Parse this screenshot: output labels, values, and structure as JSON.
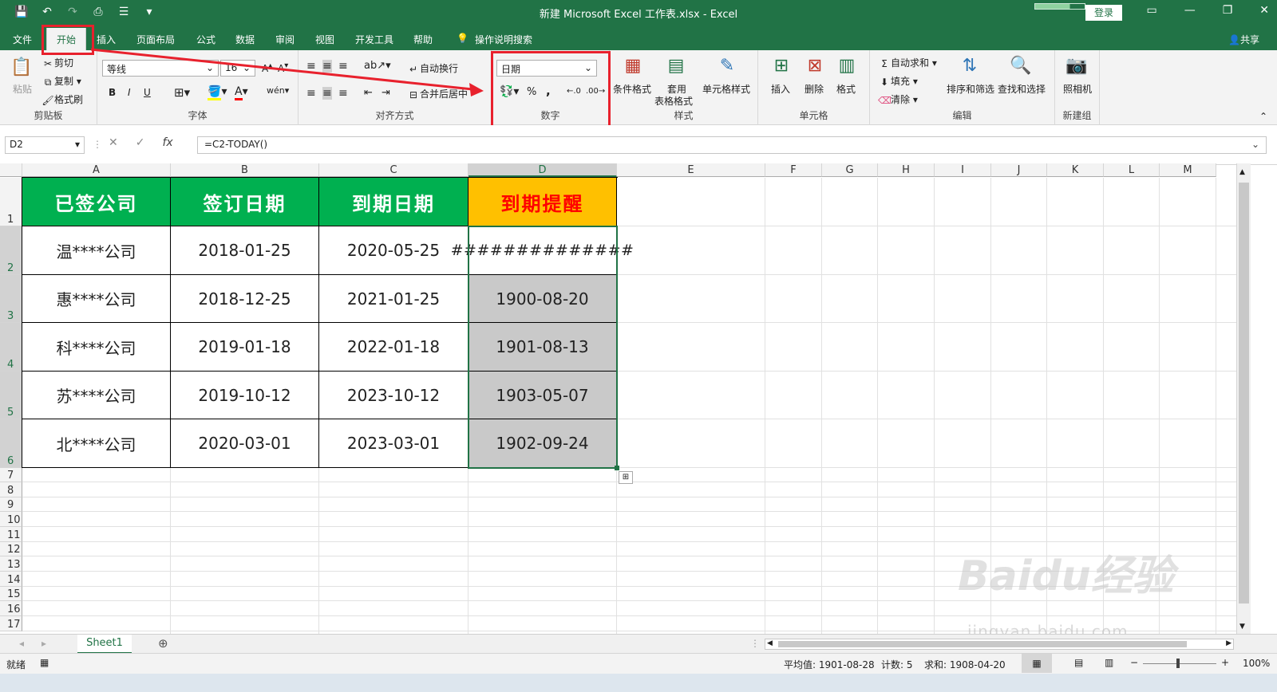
{
  "window": {
    "title": "新建 Microsoft Excel 工作表.xlsx - Excel",
    "login": "登录",
    "share": "共享"
  },
  "tabs": [
    "文件",
    "开始",
    "插入",
    "页面布局",
    "公式",
    "数据",
    "审阅",
    "视图",
    "开发工具",
    "帮助",
    "操作说明搜索"
  ],
  "ribbon": {
    "clipboard": {
      "paste": "粘贴",
      "cut": "剪切",
      "copy": "复制",
      "format_painter": "格式刷",
      "label": "剪贴板"
    },
    "font": {
      "name": "等线",
      "size": "16",
      "bold": "B",
      "italic": "I",
      "underline": "U",
      "label": "字体"
    },
    "align": {
      "wrap": "自动换行",
      "merge": "合并后居中",
      "label": "对齐方式"
    },
    "number": {
      "format": "日期",
      "percent": "%",
      "comma": ",",
      "label": "数字"
    },
    "styles": {
      "conditional": "条件格式",
      "table_line1": "套用",
      "table_line2": "表格格式",
      "cell_styles": "单元格样式",
      "label": "样式"
    },
    "cells": {
      "insert": "插入",
      "delete": "删除",
      "format": "格式",
      "label": "单元格"
    },
    "editing": {
      "autosum": "自动求和",
      "fill": "填充",
      "clear": "清除",
      "sort": "排序和筛选",
      "find": "查找和选择",
      "label": "编辑"
    },
    "newgroup": {
      "camera": "照相机",
      "label": "新建组"
    }
  },
  "formula_bar": {
    "name_box": "D2",
    "formula": "=C2-TODAY()"
  },
  "columns": [
    "A",
    "B",
    "C",
    "D",
    "E",
    "F",
    "G",
    "H",
    "I",
    "J",
    "K",
    "L",
    "M"
  ],
  "rows": [
    "1",
    "2",
    "3",
    "4",
    "5",
    "6",
    "7",
    "8",
    "9",
    "10",
    "11",
    "12",
    "13",
    "14",
    "15",
    "16",
    "17"
  ],
  "table": {
    "headers": [
      "已签公司",
      "签订日期",
      "到期日期",
      "到期提醒"
    ],
    "rows": [
      [
        "温****公司",
        "2018-01-25",
        "2020-05-25",
        "##############"
      ],
      [
        "惠****公司",
        "2018-12-25",
        "2021-01-25",
        "1900-08-20"
      ],
      [
        "科****公司",
        "2019-01-18",
        "2022-01-18",
        "1901-08-13"
      ],
      [
        "苏****公司",
        "2019-10-12",
        "2023-10-12",
        "1903-05-07"
      ],
      [
        "北****公司",
        "2020-03-01",
        "2023-03-01",
        "1902-09-24"
      ]
    ]
  },
  "sheet": {
    "name": "Sheet1"
  },
  "status": {
    "ready": "就绪",
    "average": "平均值: 1901-08-28",
    "count": "计数: 5",
    "sum": "求和: 1908-04-20",
    "zoom": "100%"
  },
  "watermark": {
    "brand": "Baidu经验",
    "url": "jingyan.baidu.com"
  },
  "colors": {
    "excel_green": "#217346",
    "header_green": "#00b050",
    "header_gold": "#ffc000",
    "alert_red": "#ff0000",
    "highlight_red": "#e8212d"
  }
}
